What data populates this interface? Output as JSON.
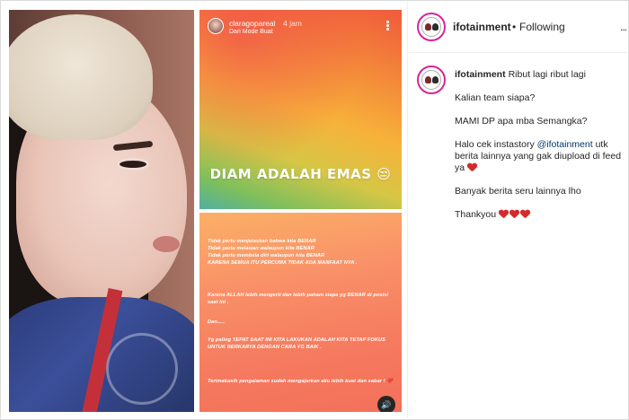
{
  "post_header": {
    "username": "ifotainment",
    "separator": "•",
    "follow_status": "Following",
    "options_label": "..."
  },
  "story_top": {
    "username": "claragopareal",
    "time": "4 jam",
    "subtitle": "Dari Mode Buat",
    "caption": "DIAM ADALAH EMAS 😒"
  },
  "story_bottom": {
    "paragraphs": [
      "Tidak perlu menjelaskan bahwa kita BENAR\nTidak perlu melawan walaupun kita BENAR\nTidak perlu membela diri walaupun kita BENAR\nKARENA SEMUA ITU PERCUMA TIDAK ADA MANFAAT NYA .",
      "Karena ALLAH lebih mengerti dan lebih paham siapa yg BENAR di posisi saat ini .",
      "Dan.....",
      "Yg paling TEPAT SAAT INI KITA LAKUKAN ADALAH KITA TETAP FOKUS UNTUK BERKARYA DENGAN CARA YG BAIK .",
      "Terimakasih pengalaman sudah mengajarkan aku lebih kuat dan sabar ! ❤️"
    ]
  },
  "caption": {
    "username": "ifotainment",
    "first_line": "Ribut lagi ribut lagi",
    "line2": "Kalian team siapa?",
    "line3": "MAMI DP apa mba Semangka?",
    "line4_prefix": "Halo cek instastory",
    "mention": "@ifotainment",
    "line4_suffix": "utk berita lainnya yang gak diupload di feed ya",
    "line5": "Banyak berita seru lainnya lho",
    "line6": "Thankyou"
  },
  "colors": {
    "heart": "#d42b2b",
    "mention": "#00376b",
    "avatar_ring": "#d6249f"
  }
}
